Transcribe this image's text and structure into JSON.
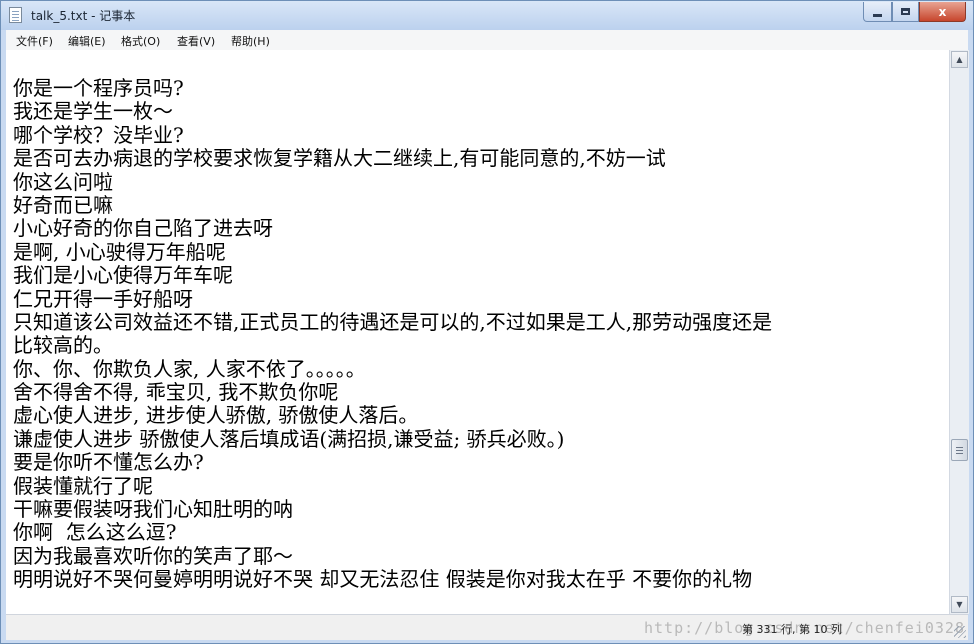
{
  "window": {
    "title": "talk_5.txt - 记事本",
    "controls": {
      "minimize": "",
      "maximize": "",
      "close": "x"
    }
  },
  "menubar": {
    "file": "文件(F)",
    "edit": "编辑(E)",
    "format": "格式(O)",
    "view": "查看(V)",
    "help": "帮助(H)"
  },
  "editor": {
    "lines": [
      "你是一个程序员吗?",
      "我还是学生一枚～",
      "哪个学校？没毕业?",
      "是否可去办病退的学校要求恢复学籍从大二继续上,有可能同意的,不妨一试",
      "你这么问啦",
      "好奇而已嘛",
      "小心好奇的你自己陷了进去呀",
      "是啊, 小心驶得万年船呢",
      "我们是小心使得万年车呢",
      "仁兄开得一手好船呀",
      "只知道该公司效益还不错,正式员工的待遇还是可以的,不过如果是工人,那劳动强度还是",
      "比较高的。",
      "你、你、你欺负人家, 人家不依了。。。。。",
      "舍不得舍不得, 乖宝贝, 我不欺负你呢",
      "虚心使人进步, 进步使人骄傲, 骄傲使人落后。",
      "谦虚使人进步 骄傲使人落后填成语(满招损,谦受益; 骄兵必败。)",
      "要是你听不懂怎么办?",
      "假装懂就行了呢",
      "干嘛要假装呀我们心知肚明的呐",
      "你啊  怎么这么逗?",
      "因为我最喜欢听你的笑声了耶～",
      "明明说好不哭何曼婷明明说好不哭 却又无法忍住 假装是你对我太在乎 不要你的礼物"
    ]
  },
  "scrollbar": {
    "up_arrow": "▲",
    "down_arrow": "▼"
  },
  "statusbar": {
    "position": "第 331 行, 第 10 列",
    "watermark": "http://blog.csdn.net/chenfei0328"
  }
}
